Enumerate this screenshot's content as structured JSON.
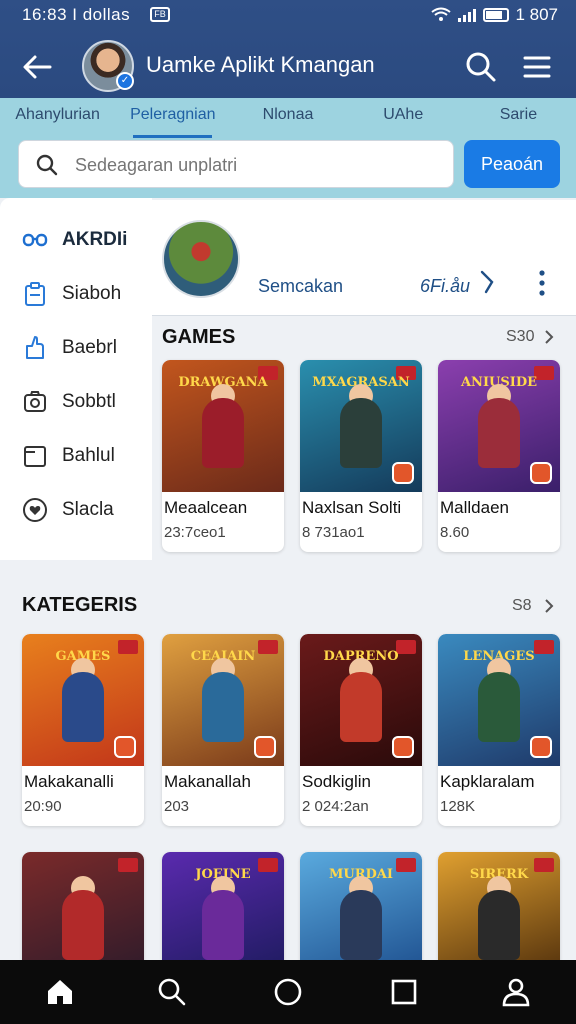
{
  "status": {
    "time": "16:83 I dollas",
    "notif": "FB",
    "battery": "1 807"
  },
  "appbar": {
    "title": "Uamke Aplikt Kmangan"
  },
  "tabs": [
    {
      "label": "Ahanylurian",
      "active": false
    },
    {
      "label": "Peleragnian",
      "active": true
    },
    {
      "label": "Nlonaa",
      "active": false
    },
    {
      "label": "UAhe",
      "active": false
    },
    {
      "label": "Sarie",
      "active": false
    }
  ],
  "search": {
    "placeholder": "Sedeagaran unplatri",
    "button": "Peaoán"
  },
  "sidebar": {
    "items": [
      {
        "label": "AKRDIi",
        "icon": "glasses-icon",
        "active": true
      },
      {
        "label": "Siaboh",
        "icon": "clipboard-icon",
        "active": false
      },
      {
        "label": "Baebrl",
        "icon": "thumb-icon",
        "active": false
      },
      {
        "label": "Sobbtl",
        "icon": "camera-icon",
        "active": false
      },
      {
        "label": "Bahlul",
        "icon": "folder-icon",
        "active": false
      },
      {
        "label": "Slacla",
        "icon": "heart-icon",
        "active": false
      }
    ]
  },
  "profile": {
    "name": "Semcakan",
    "stat": "6Fi.åu"
  },
  "games": {
    "title": "GAMES",
    "more": "S30",
    "items": [
      {
        "title": "Meaalcean",
        "meta": "23:7ceo1",
        "banner": "DRAWGANA",
        "colors": [
          "#c2561d",
          "#6b2a1a"
        ],
        "fig": "#9b1d2a"
      },
      {
        "title": "Naxlsan Solti",
        "meta": "8 731ao1",
        "banner": "MXAGRASAN",
        "colors": [
          "#2a8fae",
          "#143a5a"
        ],
        "fig": "#2b3f3a"
      },
      {
        "title": "Malldaen",
        "meta": "8.60",
        "banner": "ANIUSIDE",
        "colors": [
          "#8b3fae",
          "#3a1f6a"
        ],
        "fig": "#9b2d3a"
      }
    ]
  },
  "kategoris": {
    "title": "KATEGERIS",
    "more": "S8",
    "items": [
      {
        "title": "Makakanalli",
        "meta": "20:90",
        "banner": "GAMES",
        "colors": [
          "#e8801d",
          "#c2361a"
        ],
        "fig": "#2a4a8a"
      },
      {
        "title": "Makanallah",
        "meta": "203",
        "banner": "CEAIAIN",
        "colors": [
          "#e0a040",
          "#7a3a1a"
        ],
        "fig": "#2a6a9a"
      },
      {
        "title": "Sodkiglin",
        "meta": "2 024:2an",
        "banner": "DAPRENO",
        "colors": [
          "#6a1a1a",
          "#2a0a0a"
        ],
        "fig": "#c23a2a"
      },
      {
        "title": "Kapklaralam",
        "meta": "128K",
        "banner": "LENAGES",
        "colors": [
          "#3a8abf",
          "#1f3a6a"
        ],
        "fig": "#2a5a3a"
      }
    ]
  },
  "third_row": [
    {
      "banner": "",
      "colors": [
        "#7a2a2a",
        "#2a1a2a"
      ],
      "fig": "#b22a2a"
    },
    {
      "banner": "JOEINE",
      "colors": [
        "#5a2aae",
        "#1a1a5a"
      ],
      "fig": "#6a2a9a"
    },
    {
      "banner": "MURDAI",
      "colors": [
        "#5aaade",
        "#1a4a8a"
      ],
      "fig": "#2a3a5a"
    },
    {
      "banner": "SIRERK",
      "colors": [
        "#e0a030",
        "#4a2a0a"
      ],
      "fig": "#2a2a2a"
    }
  ],
  "bottom_nav": [
    "home-icon",
    "search-icon",
    "circle-icon",
    "square-icon",
    "profile-icon"
  ]
}
